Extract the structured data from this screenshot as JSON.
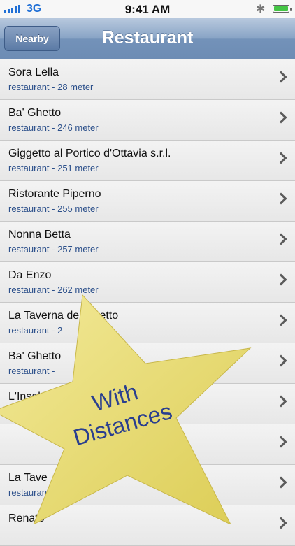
{
  "status_bar": {
    "carrier": "3G",
    "time": "9:41 AM",
    "icons": [
      "signal-icon",
      "bluetooth-icon",
      "battery-icon"
    ],
    "battery_level": 1.0
  },
  "nav_bar": {
    "back_label": "Nearby",
    "title": "Restaurant"
  },
  "items": [
    {
      "name": "Sora Lella",
      "detail": "restaurant - 28 meter"
    },
    {
      "name": "Ba' Ghetto",
      "detail": "restaurant - 246 meter"
    },
    {
      "name": "Giggetto al Portico d'Ottavia s.r.l.",
      "detail": "restaurant - 251 meter"
    },
    {
      "name": "Ristorante Piperno",
      "detail": "restaurant - 255 meter"
    },
    {
      "name": "Nonna Betta",
      "detail": "restaurant - 257 meter"
    },
    {
      "name": "Da Enzo",
      "detail": "restaurant - 262 meter"
    },
    {
      "name": "La Taverna del Ghetto",
      "detail": "restaurant - 2"
    },
    {
      "name": "Ba' Ghetto",
      "detail": "restaurant - "
    },
    {
      "name": "L'Insala",
      "detail": "re"
    },
    {
      "name": "",
      "detail": ""
    },
    {
      "name": "La Tave",
      "detail": "restaurant"
    },
    {
      "name": "Renato",
      "detail": ""
    }
  ],
  "badge": {
    "line1": "With",
    "line2": "Distances",
    "colors": {
      "fill": "#e9dc72",
      "text": "#2a3f8f"
    }
  }
}
